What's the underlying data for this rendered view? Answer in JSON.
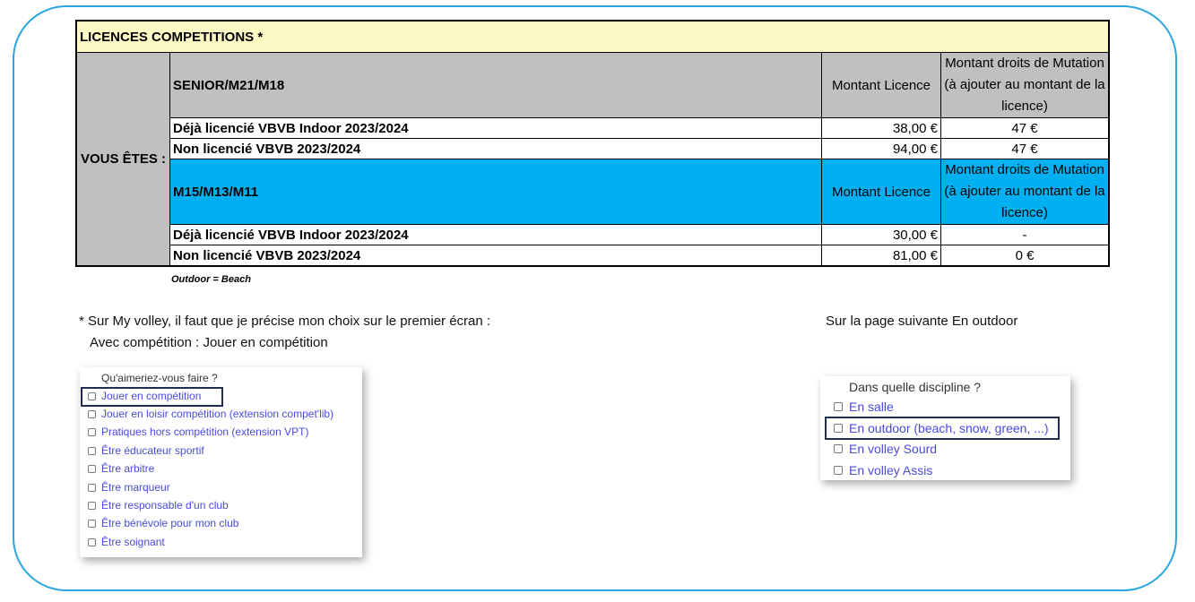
{
  "title": "LICENCES COMPETITIONS *",
  "vous_etes": "VOUS ÊTES :",
  "sections": [
    {
      "category": "SENIOR/M21/M18",
      "col_licence": "Montant Licence",
      "col_mutation": "Montant droits de Mutation (à ajouter au montant de la licence)",
      "rows": [
        {
          "label": "Déjà licencié VBVB Indoor 2023/2024",
          "licence": "38,00 €",
          "mutation": "47 €"
        },
        {
          "label": "Non licencié VBVB 2023/2024",
          "licence": "94,00 €",
          "mutation": "47 €"
        }
      ]
    },
    {
      "category": "M15/M13/M11",
      "col_licence": "Montant Licence",
      "col_mutation": "Montant droits de Mutation (à ajouter au montant de la licence)",
      "rows": [
        {
          "label": "Déjà licencié VBVB Indoor 2023/2024",
          "licence": "30,00 €",
          "mutation": "-"
        },
        {
          "label": "Non licencié VBVB 2023/2024",
          "licence": "81,00 €",
          "mutation": "0 €"
        }
      ]
    }
  ],
  "note": "Outdoor = Beach",
  "instructions": {
    "line1": "* Sur My volley, il faut que je précise mon choix sur le premier écran :",
    "line2": "Avec compétition : Jouer en compétition",
    "right": "Sur la page suivante En outdoor"
  },
  "panel_left": {
    "question": "Qu'aimeriez-vous faire ?",
    "options": [
      "Jouer en compétition",
      "Jouer en loisir compétition (extension compet'lib)",
      "Pratiques hors compétition (extension VPT)",
      "Être éducateur sportif",
      "Être arbitre",
      "Être marqueur",
      "Être responsable d'un club",
      "Être bénévole pour mon club",
      "Être soignant"
    ]
  },
  "panel_right": {
    "question": "Dans quelle discipline ?",
    "options": [
      "En salle",
      "En outdoor (beach, snow, green, ...)",
      "En volley Sourd",
      "En volley Assis"
    ]
  },
  "colors": {
    "frame": "#2aa6de",
    "title_bg": "#fdf9c5",
    "senior_bg": "#c0c0c0",
    "youth_bg": "#00b0f0",
    "option_text": "#4a4ae0",
    "highlight": "#1f2d4f"
  }
}
